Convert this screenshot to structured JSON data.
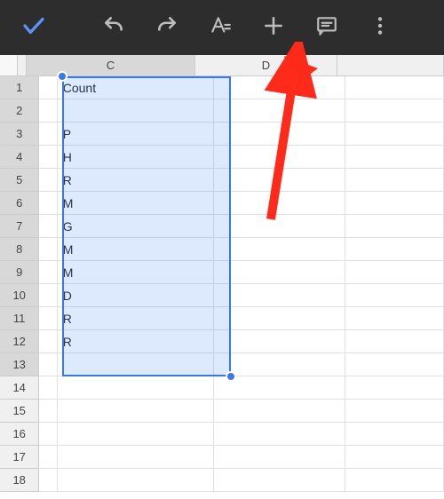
{
  "toolbar": {
    "check": "check",
    "undo": "undo",
    "redo": "redo",
    "format": "text-format",
    "insert": "insert",
    "comment": "comment",
    "more": "more"
  },
  "columns": [
    {
      "label": "C",
      "width": 190,
      "selected": true
    },
    {
      "label": "D",
      "width": 160,
      "selected": false
    },
    {
      "label": "",
      "width": 120,
      "selected": false
    }
  ],
  "rows": [
    {
      "num": "1",
      "sel": true,
      "cells": [
        "Count",
        "",
        ""
      ]
    },
    {
      "num": "2",
      "sel": true,
      "cells": [
        "",
        "",
        ""
      ]
    },
    {
      "num": "3",
      "sel": true,
      "cells": [
        "P",
        "",
        ""
      ]
    },
    {
      "num": "4",
      "sel": true,
      "cells": [
        "H",
        "",
        ""
      ]
    },
    {
      "num": "5",
      "sel": true,
      "cells": [
        "R",
        "",
        ""
      ]
    },
    {
      "num": "6",
      "sel": true,
      "cells": [
        "M",
        "",
        ""
      ]
    },
    {
      "num": "7",
      "sel": true,
      "cells": [
        "G",
        "",
        ""
      ]
    },
    {
      "num": "8",
      "sel": true,
      "cells": [
        "M",
        "",
        ""
      ]
    },
    {
      "num": "9",
      "sel": true,
      "cells": [
        "M",
        "",
        ""
      ]
    },
    {
      "num": "10",
      "sel": true,
      "cells": [
        "D",
        "",
        ""
      ]
    },
    {
      "num": "11",
      "sel": true,
      "cells": [
        "R",
        "",
        ""
      ]
    },
    {
      "num": "12",
      "sel": true,
      "cells": [
        "R",
        "",
        ""
      ]
    },
    {
      "num": "13",
      "sel": true,
      "cells": [
        "",
        "",
        ""
      ]
    },
    {
      "num": "14",
      "sel": false,
      "cells": [
        "",
        "",
        ""
      ]
    },
    {
      "num": "15",
      "sel": false,
      "cells": [
        "",
        "",
        ""
      ]
    },
    {
      "num": "16",
      "sel": false,
      "cells": [
        "",
        "",
        ""
      ]
    },
    {
      "num": "17",
      "sel": false,
      "cells": [
        "",
        "",
        ""
      ]
    },
    {
      "num": "18",
      "sel": false,
      "cells": [
        "",
        "",
        ""
      ]
    }
  ],
  "annotation": {
    "arrow_color": "#ff2a1a"
  }
}
